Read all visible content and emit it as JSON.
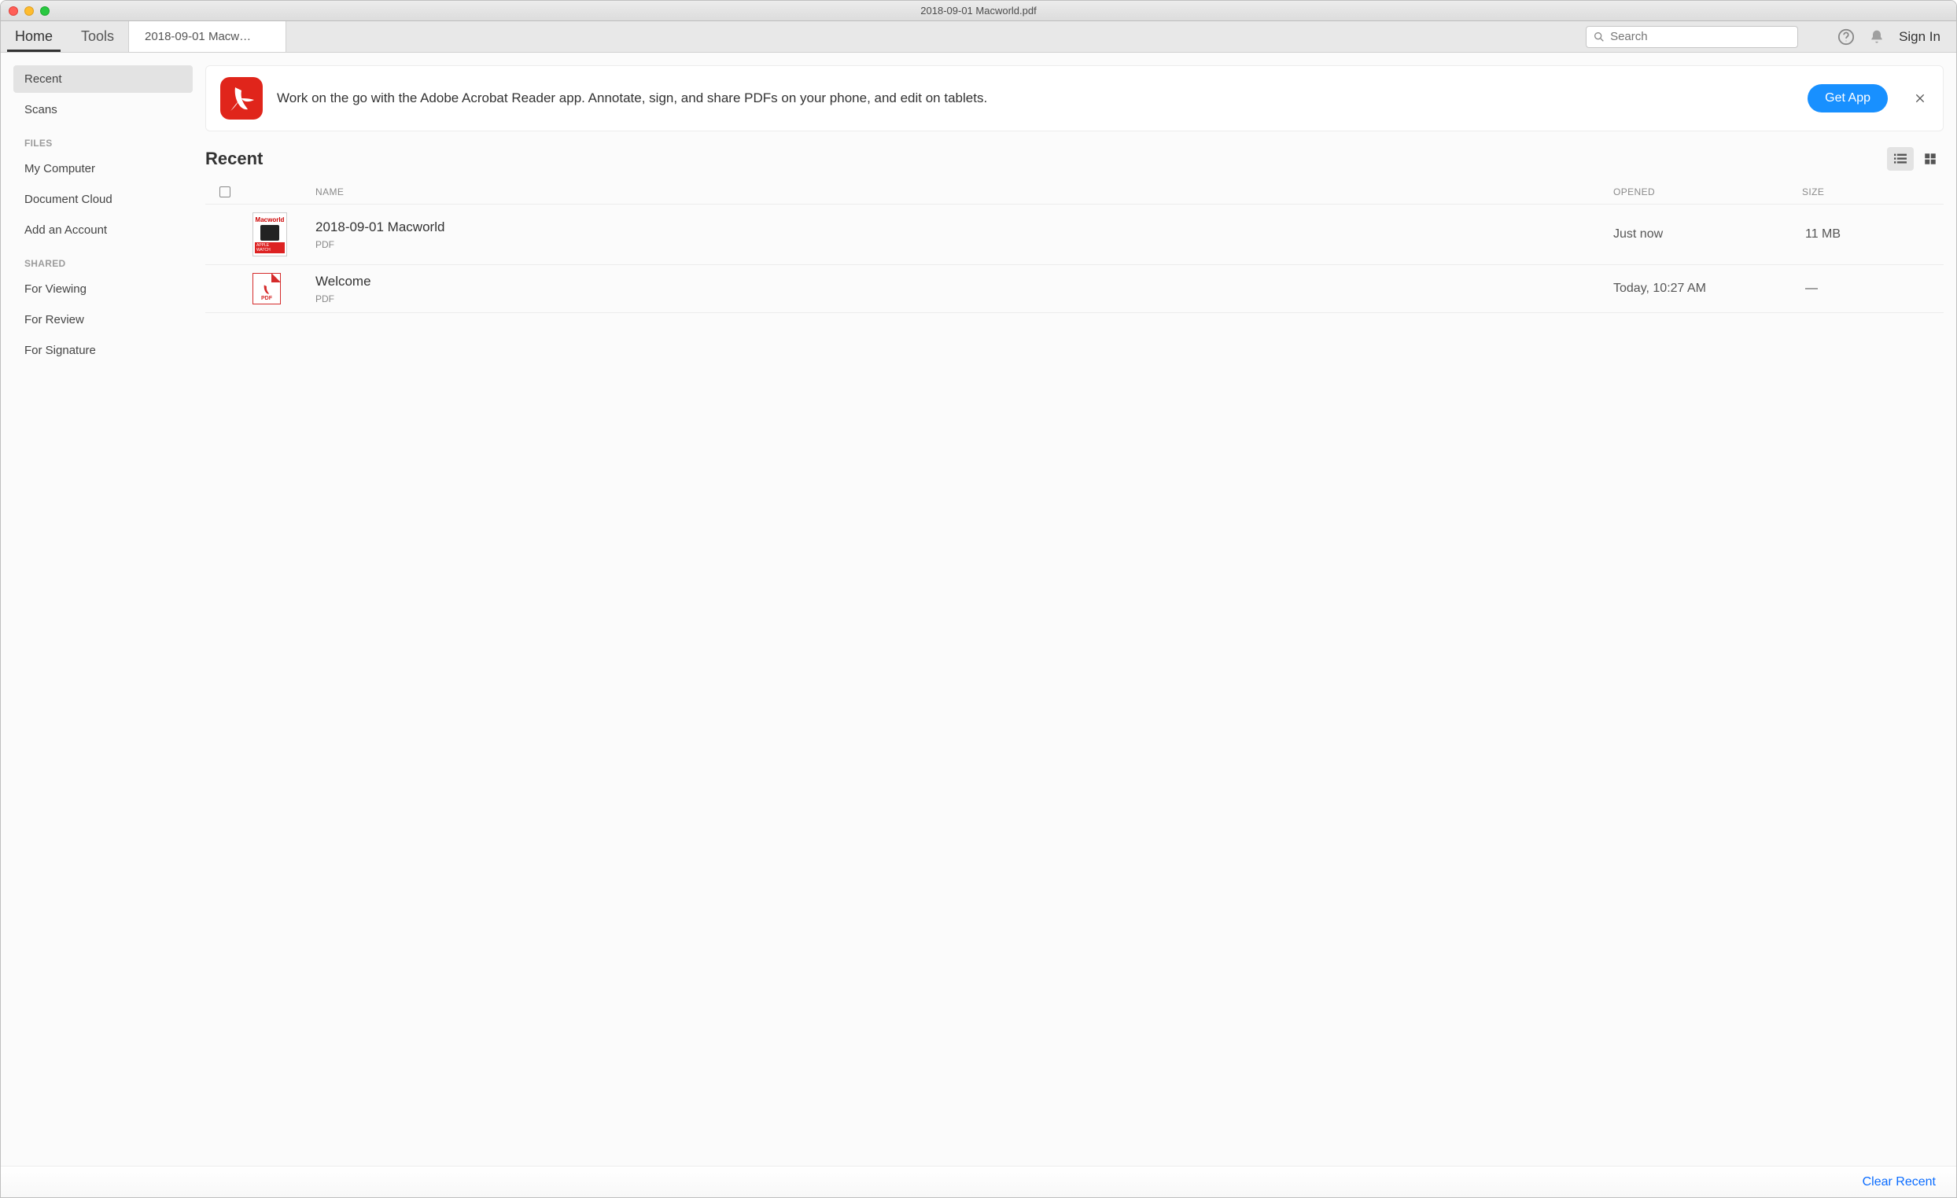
{
  "window": {
    "title": "2018-09-01 Macworld.pdf"
  },
  "topbar": {
    "tabs": {
      "home": "Home",
      "tools": "Tools"
    },
    "document_tab": "2018-09-01 Macw…",
    "search_placeholder": "Search",
    "signin": "Sign In"
  },
  "sidebar": {
    "recent": "Recent",
    "scans": "Scans",
    "files_header": "FILES",
    "files": {
      "my_computer": "My Computer",
      "document_cloud": "Document Cloud",
      "add_account": "Add an Account"
    },
    "shared_header": "SHARED",
    "shared": {
      "for_viewing": "For Viewing",
      "for_review": "For Review",
      "for_signature": "For Signature"
    }
  },
  "banner": {
    "text": "Work on the go with the Adobe Acrobat Reader app. Annotate, sign, and share PDFs on your phone, and edit on tablets.",
    "button": "Get App"
  },
  "section": {
    "title": "Recent"
  },
  "table": {
    "columns": {
      "name": "NAME",
      "opened": "OPENED",
      "size": "SIZE"
    },
    "rows": [
      {
        "name": "2018-09-01 Macworld",
        "type": "PDF",
        "opened": "Just now",
        "size": "11 MB",
        "thumb_kind": "magazine",
        "thumb_title": "Macworld",
        "thumb_sub": "APPLE WATCH"
      },
      {
        "name": "Welcome",
        "type": "PDF",
        "opened": "Today, 10:27 AM",
        "size": "—",
        "thumb_kind": "pdficon",
        "thumb_label": "PDF"
      }
    ]
  },
  "footer": {
    "clear": "Clear Recent"
  }
}
